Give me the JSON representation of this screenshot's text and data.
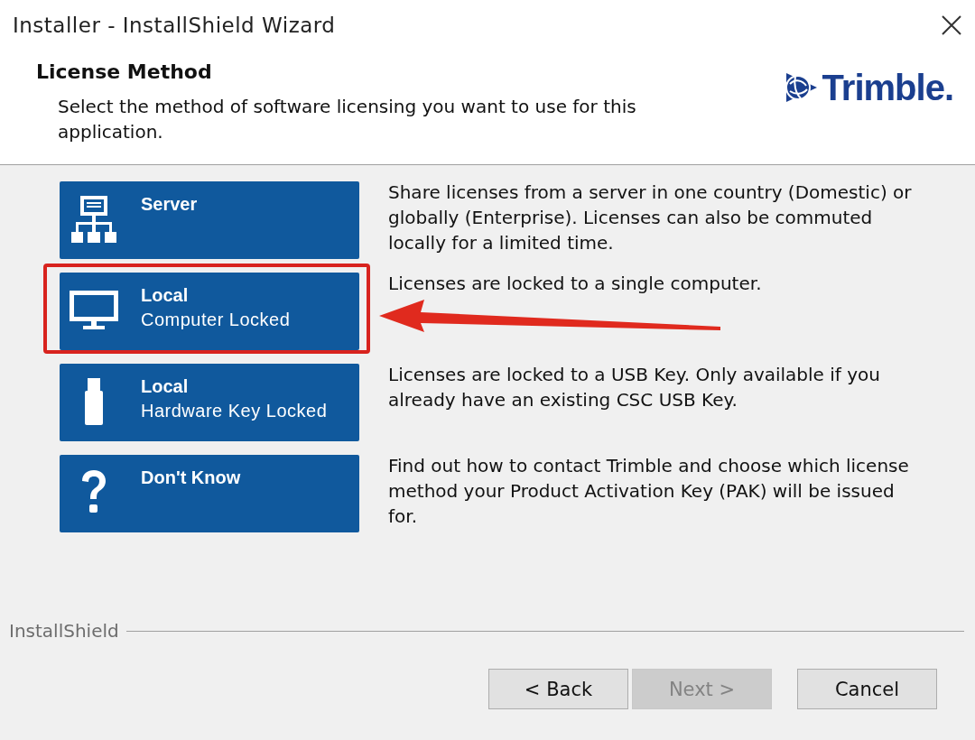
{
  "window": {
    "title": "Installer - InstallShield Wizard"
  },
  "header": {
    "title": "License Method",
    "subtitle": "Select the method of software licensing you want to use for this application.",
    "logo_text": "Trimble."
  },
  "options": [
    {
      "kind": "server",
      "title": "Server",
      "description": "Share licenses from a server in one country (Domestic) or globally (Enterprise). Licenses can also be commuted locally for a limited time.",
      "highlighted": false
    },
    {
      "kind": "computer",
      "title": "Local",
      "subtitle": "Computer Locked",
      "description": "Licenses are locked to a single computer.",
      "highlighted": true
    },
    {
      "kind": "usb",
      "title": "Local",
      "subtitle": "Hardware Key Locked",
      "description": "Licenses are locked to a USB Key. Only available if you already have an existing CSC USB Key.",
      "highlighted": false
    },
    {
      "kind": "unknown",
      "title": "Don't Know",
      "description": "Find out how to contact Trimble and choose which license method your Product Activation Key (PAK) will be issued for.",
      "highlighted": false
    }
  ],
  "footer": {
    "brand": "InstallShield"
  },
  "buttons": [
    {
      "label": "< Back",
      "disabled": false
    },
    {
      "label": "Next >",
      "disabled": true
    },
    {
      "label": "Cancel",
      "disabled": false
    }
  ]
}
